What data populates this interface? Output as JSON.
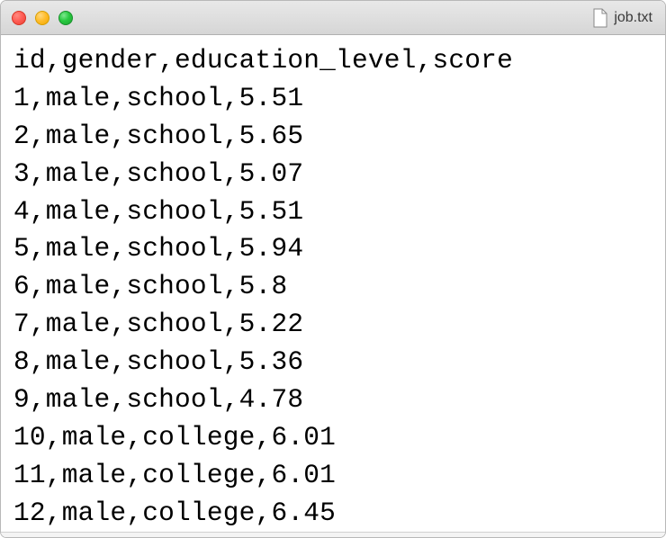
{
  "window": {
    "title": "job.txt"
  },
  "content": {
    "lines": [
      "id,gender,education_level,score",
      "1,male,school,5.51",
      "2,male,school,5.65",
      "3,male,school,5.07",
      "4,male,school,5.51",
      "5,male,school,5.94",
      "6,male,school,5.8",
      "7,male,school,5.22",
      "8,male,school,5.36",
      "9,male,school,4.78",
      "10,male,college,6.01",
      "11,male,college,6.01",
      "12,male,college,6.45"
    ]
  }
}
